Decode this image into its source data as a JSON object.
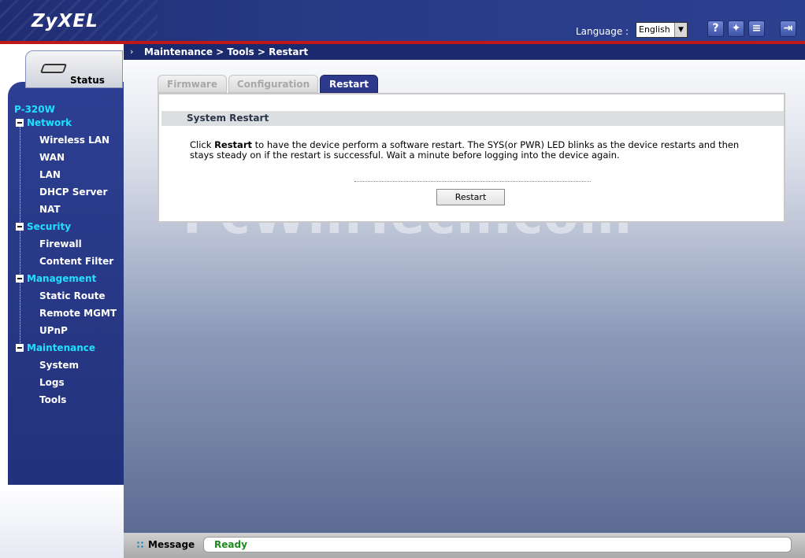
{
  "header": {
    "logo": "ZyXEL",
    "language_label": "Language :",
    "language_value": "English",
    "icons": [
      "help-icon",
      "wizard-icon",
      "about-icon",
      "logout-icon"
    ]
  },
  "sidebar": {
    "status_label": "Status",
    "model": "P-320W",
    "groups": [
      {
        "label": "Network",
        "items": [
          "Wireless LAN",
          "WAN",
          "LAN",
          "DHCP Server",
          "NAT"
        ]
      },
      {
        "label": "Security",
        "items": [
          "Firewall",
          "Content Filter"
        ]
      },
      {
        "label": "Management",
        "items": [
          "Static Route",
          "Remote MGMT",
          "UPnP"
        ]
      },
      {
        "label": "Maintenance",
        "items": [
          "System",
          "Logs",
          "Tools"
        ]
      }
    ]
  },
  "main": {
    "breadcrumb": "Maintenance > Tools > Restart",
    "tabs": [
      {
        "label": "Firmware",
        "active": false
      },
      {
        "label": "Configuration",
        "active": false
      },
      {
        "label": "Restart",
        "active": true
      }
    ],
    "section_title": "System Restart",
    "desc_prefix": "Click ",
    "desc_bold": "Restart",
    "desc_suffix": " to have the device perform a software restart. The SYS(or PWR) LED blinks as the device restarts and then stays steady on if the restart is successful. Wait a minute before logging into the device again.",
    "restart_button": "Restart",
    "watermark": "PcWinTech.com"
  },
  "statusbar": {
    "message_label": "Message",
    "message_value": "Ready"
  },
  "colors": {
    "header_bg": "#283a86",
    "accent_red": "#c01818",
    "nav_group": "#20e0ff",
    "active_tab": "#2d3a8c",
    "ready_green": "#1c8c1c"
  }
}
